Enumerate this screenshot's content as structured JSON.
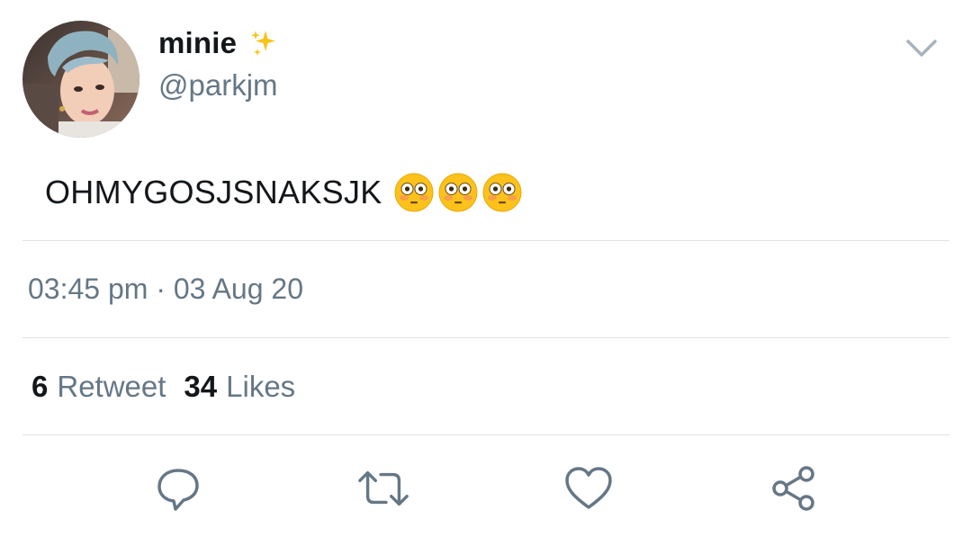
{
  "tweet": {
    "display_name": "minie",
    "name_emoji": "sparkles-icon",
    "handle": "@parkjm",
    "text": "OHMYGOSJSNAKSJK",
    "text_emojis": [
      "flushed-face-icon",
      "flushed-face-icon",
      "flushed-face-icon"
    ],
    "timestamp": "03:45 pm · 03 Aug 20",
    "retweet_count": "6",
    "retweet_label": "Retweet",
    "likes_count": "34",
    "likes_label": "Likes"
  },
  "actions": [
    {
      "name": "reply",
      "icon": "comment-icon"
    },
    {
      "name": "retweet",
      "icon": "retweet-icon"
    },
    {
      "name": "like",
      "icon": "heart-icon"
    },
    {
      "name": "share",
      "icon": "share-icon"
    }
  ],
  "colors": {
    "primary_text": "#14171a",
    "secondary_text": "#657786",
    "divider": "#dfe3e7",
    "icon": "#657786",
    "sparkle": "#f5c518"
  }
}
